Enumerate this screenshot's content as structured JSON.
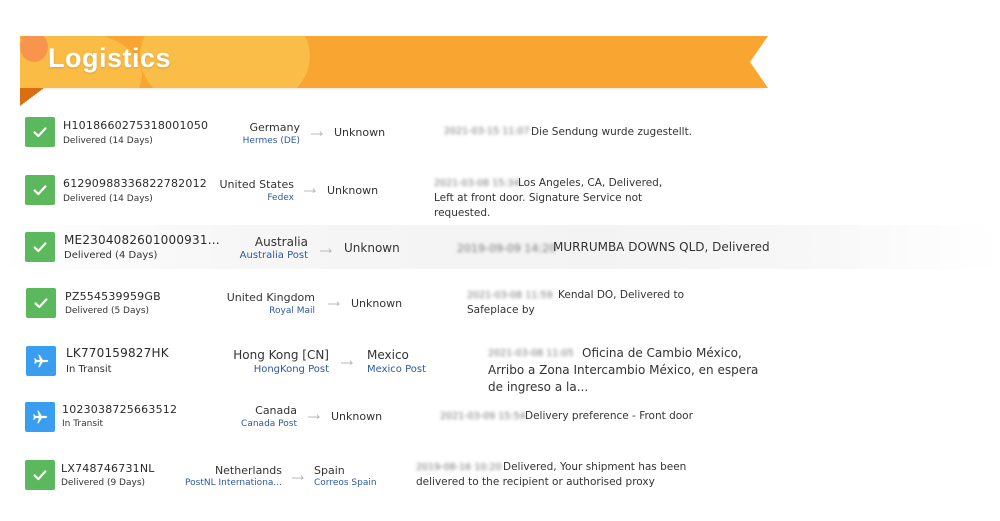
{
  "header": {
    "title": "Logistics"
  },
  "shipments": [
    {
      "tracking": "H1018660275318001050",
      "status": "Delivered (14 Days)",
      "status_type": "delivered",
      "origin": "Germany",
      "carrier_origin": "Hermes (DE)",
      "destination": "Unknown",
      "carrier_destination": "",
      "event": "Die Sendung wurde zugestellt.",
      "event_time": "2021-03-15 11:07"
    },
    {
      "tracking": "61290988336822782012",
      "status": "Delivered (14 Days)",
      "status_type": "delivered",
      "origin": "United States",
      "carrier_origin": "Fedex",
      "destination": "Unknown",
      "carrier_destination": "",
      "event": "Los Angeles, CA, Delivered, Left at front door. Signature Service not requested.",
      "event_time": "2021-03-08 15:34"
    },
    {
      "tracking": "ME2304082601000931...",
      "status": "Delivered (4 Days)",
      "status_type": "delivered",
      "origin": "Australia",
      "carrier_origin": "Australia Post",
      "destination": "Unknown",
      "carrier_destination": "",
      "event": "MURRUMBA DOWNS QLD, Delivered",
      "event_time": "2019-09-09 14:20"
    },
    {
      "tracking": "PZ554539959GB",
      "status": "Delivered (5 Days)",
      "status_type": "delivered",
      "origin": "United Kingdom",
      "carrier_origin": "Royal Mail",
      "destination": "Unknown",
      "carrier_destination": "",
      "event": "Kendal DO, Delivered to Safeplace by",
      "event_time": "2021-03-08 11:59"
    },
    {
      "tracking": "LK770159827HK",
      "status": "In Transit",
      "status_type": "transit",
      "origin": "Hong Kong [CN]",
      "carrier_origin": "HongKong Post",
      "destination": "Mexico",
      "carrier_destination": "Mexico Post",
      "event": "Oficina de Cambio México, Arribo a Zona Intercambio México, en espera de ingreso a la...",
      "event_time": "2021-03-08 11:05"
    },
    {
      "tracking": "1023038725663512",
      "status": "In Transit",
      "status_type": "transit",
      "origin": "Canada",
      "carrier_origin": "Canada Post",
      "destination": "Unknown",
      "carrier_destination": "",
      "event": "Delivery preference - Front door",
      "event_time": "2021-03-09 15:54"
    },
    {
      "tracking": "LX748746731NL",
      "status": "Delivered (9 Days)",
      "status_type": "delivered",
      "origin": "Netherlands",
      "carrier_origin": "PostNL Internationa...",
      "destination": "Spain",
      "carrier_destination": "Correos Spain",
      "event": "Delivered, Your shipment has been delivered to the recipient or authorised proxy",
      "event_time": "2019-08-16 10:20"
    }
  ],
  "colors": {
    "banner": "#f9a532",
    "delivered": "#5cb85c",
    "transit": "#3a9ef0",
    "carrier_link": "#2c5aa0"
  },
  "icons": {
    "delivered": "check-icon",
    "transit": "airplane-icon"
  }
}
